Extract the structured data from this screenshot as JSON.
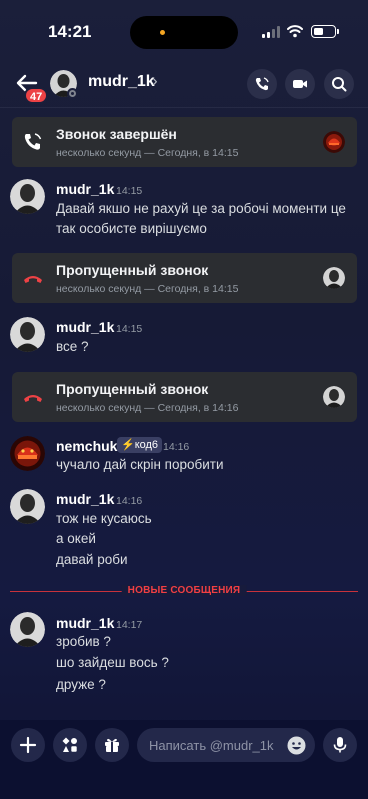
{
  "status_bar": {
    "time": "14:21"
  },
  "header": {
    "back_badge": "47",
    "name": "mudr_1k",
    "chevron": "›"
  },
  "calls": [
    {
      "title": "Звонок завершён",
      "subtitle": "несколько секунд — Сегодня, в 14:15",
      "icon": "call-ended-icon"
    },
    {
      "title": "Пропущенный звонок",
      "subtitle": "несколько секунд — Сегодня, в 14:15",
      "icon": "missed-call-icon"
    },
    {
      "title": "Пропущенный звонок",
      "subtitle": "несколько секунд — Сегодня, в 14:16",
      "icon": "missed-call-icon"
    }
  ],
  "messages": [
    {
      "author": "mudr_1k",
      "time": "14:15",
      "lines": [
        "Давай якшо не рахуй це за робочі моменти це",
        "так особисте вирішуємо"
      ]
    },
    {
      "author": "mudr_1k",
      "time": "14:15",
      "lines": [
        "все ?"
      ]
    },
    {
      "author": "nemchuk",
      "tag": "⚡код6",
      "time": "14:16",
      "lines": [
        "чучало дай скрін поробити"
      ]
    },
    {
      "author": "mudr_1k",
      "time": "14:16",
      "lines": [
        "тож не кусаюсь",
        "а окей",
        "давай роби"
      ]
    },
    {
      "author": "mudr_1k",
      "time": "14:17",
      "lines": [
        "зробив ?",
        "шо зайдеш вось ?",
        "друже ?"
      ]
    }
  ],
  "new_messages_label": "НОВЫЕ СООБЩЕНИЯ",
  "composer": {
    "placeholder": "Написать @mudr_1k"
  },
  "colors": {
    "accent_red": "#ed4245",
    "card_bg": "#2b2d31",
    "divider": "#f23f43"
  }
}
